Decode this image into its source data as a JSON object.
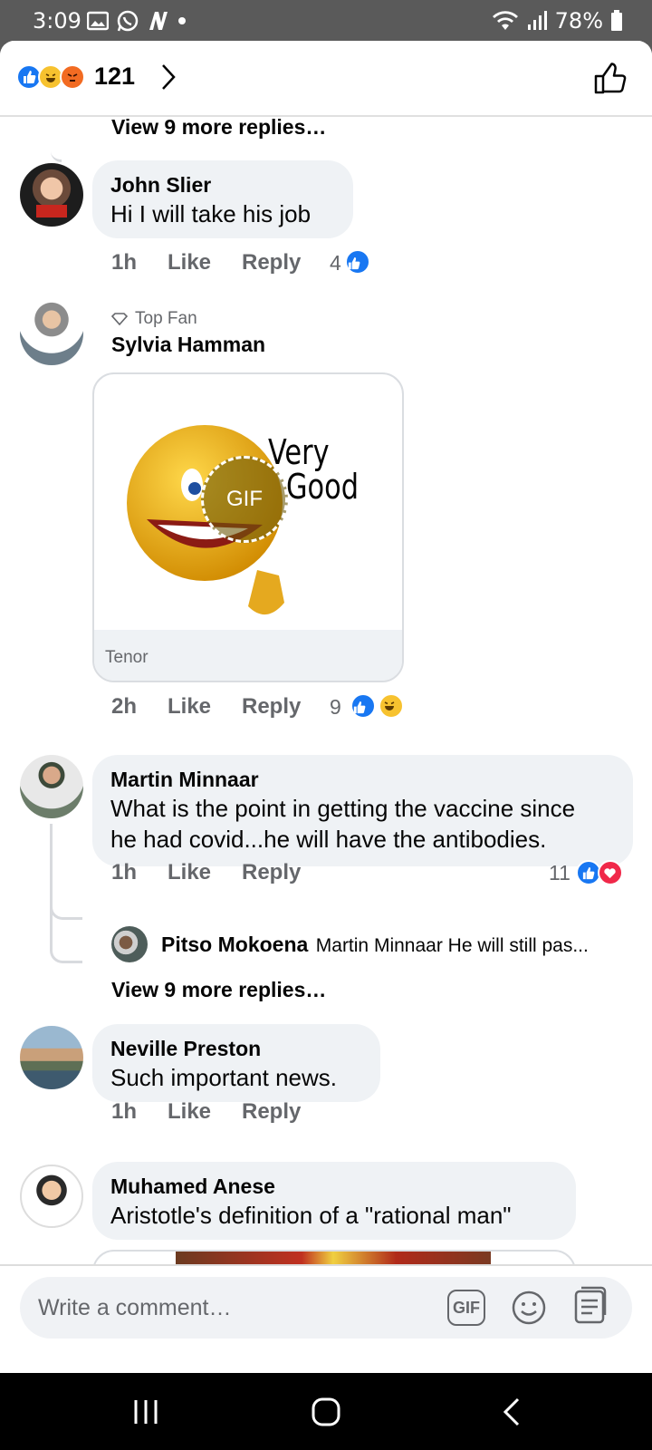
{
  "status_bar": {
    "time": "3:09",
    "battery": "78%"
  },
  "header": {
    "reaction_count": "121",
    "reaction_icons": [
      "like-icon",
      "haha-icon",
      "angry-icon"
    ]
  },
  "comments": [
    {
      "view_more": "View 9 more replies…"
    },
    {
      "name": "John Slier",
      "text": "Hi I will take his job",
      "time": "1h",
      "like": "Like",
      "reply": "Reply",
      "reactions": "4"
    },
    {
      "badge": "Top Fan",
      "name": "Sylvia Hamman",
      "gif_text_1": "Very",
      "gif_text_2": "Good",
      "gif_label": "GIF",
      "gif_source": "Tenor",
      "time": "2h",
      "like": "Like",
      "reply": "Reply",
      "reactions": "9"
    },
    {
      "name": "Martin Minnaar",
      "text_line1": "What is the point in getting the vaccine since",
      "text_line2": "he had covid...he will have the antibodies.",
      "time": "1h",
      "like": "Like",
      "reply": "Reply",
      "reactions": "11",
      "reply_preview": {
        "name": "Pitso Mokoena",
        "text": "Martin Minnaar He will still pas..."
      },
      "view_more": "View 9 more replies…"
    },
    {
      "name": "Neville Preston",
      "text": "Such important news.",
      "time": "1h",
      "like": "Like",
      "reply": "Reply"
    },
    {
      "name": "Muhamed Anese",
      "text": "Aristotle's definition of a  \"rational man\""
    }
  ],
  "composer": {
    "placeholder": "Write a comment…",
    "gif_label": "GIF"
  },
  "colors": {
    "accent": "#1877f2",
    "bubble": "#eff2f5",
    "muted": "#65676b"
  }
}
